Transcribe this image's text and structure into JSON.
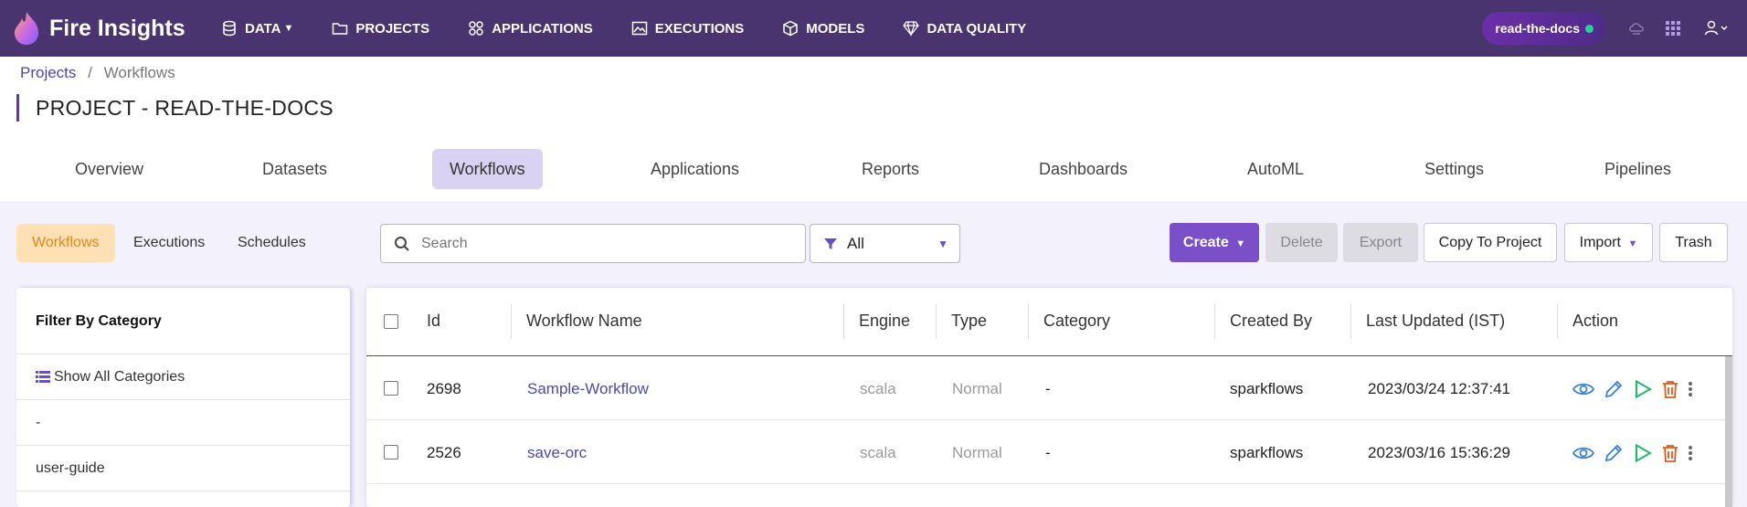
{
  "app": {
    "name": "Fire Insights"
  },
  "nav": {
    "items": [
      {
        "label": "DATA",
        "icon": "database-icon",
        "dropdown": true
      },
      {
        "label": "PROJECTS",
        "icon": "folder-icon"
      },
      {
        "label": "APPLICATIONS",
        "icon": "apps-grid-icon"
      },
      {
        "label": "EXECUTIONS",
        "icon": "image-chart-icon"
      },
      {
        "label": "MODELS",
        "icon": "cube-icon"
      },
      {
        "label": "DATA QUALITY",
        "icon": "diamond-icon"
      }
    ],
    "project_badge": "read-the-docs",
    "colors": {
      "bar": "#4a3470",
      "status_dot": "#2ecc9a"
    }
  },
  "breadcrumb": {
    "root": "Projects",
    "separator": "/",
    "current": "Workflows"
  },
  "page_title": "PROJECT - READ-THE-DOCS",
  "tabs": [
    "Overview",
    "Datasets",
    "Workflows",
    "Applications",
    "Reports",
    "Dashboards",
    "AutoML",
    "Settings",
    "Pipelines"
  ],
  "active_tab": "Workflows",
  "subtabs": [
    "Workflows",
    "Executions",
    "Schedules"
  ],
  "active_subtab": "Workflows",
  "search": {
    "placeholder": "Search",
    "value": ""
  },
  "filter": {
    "selected": "All"
  },
  "buttons": {
    "create": "Create",
    "delete": "Delete",
    "export": "Export",
    "copy_to_project": "Copy To Project",
    "import": "Import",
    "trash": "Trash"
  },
  "category_filter": {
    "title": "Filter By Category",
    "items": [
      "Show All Categories",
      "-",
      "user-guide"
    ]
  },
  "table": {
    "columns": [
      "Id",
      "Workflow Name",
      "Engine",
      "Type",
      "Category",
      "Created By",
      "Last Updated (IST)",
      "Action"
    ],
    "rows": [
      {
        "id": "2698",
        "name": "Sample-Workflow",
        "engine": "scala",
        "type": "Normal",
        "category": "-",
        "created_by": "sparkflows",
        "last_updated": "2023/03/24 12:37:41"
      },
      {
        "id": "2526",
        "name": "save-orc",
        "engine": "scala",
        "type": "Normal",
        "category": "-",
        "created_by": "sparkflows",
        "last_updated": "2023/03/16 15:36:29"
      }
    ]
  },
  "accent_colors": {
    "primary": "#7a4fc7",
    "active_tab": "#d9d2f3",
    "active_subtab": "#fde0b3",
    "subtab_text": "#e08a1c",
    "link": "#4a4aa8"
  }
}
